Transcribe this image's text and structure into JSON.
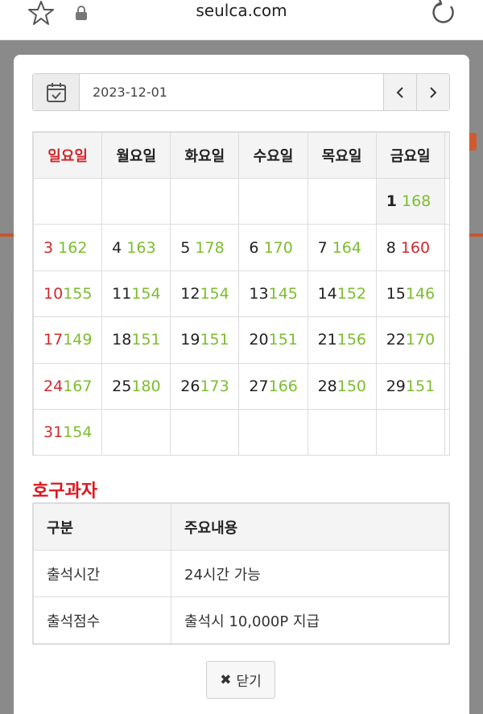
{
  "browser": {
    "url": "seulca.com"
  },
  "date_picker": {
    "value": "2023-12-01",
    "prev_label": "‹",
    "next_label": "›"
  },
  "calendar": {
    "weekdays": [
      "일요일",
      "월요일",
      "화요일",
      "수요일",
      "목요일",
      "금요일"
    ],
    "weeks": [
      [
        {
          "day": "",
          "count": ""
        },
        {
          "day": "",
          "count": ""
        },
        {
          "day": "",
          "count": ""
        },
        {
          "day": "",
          "count": ""
        },
        {
          "day": "",
          "count": ""
        },
        {
          "day": "1",
          "count": "168"
        }
      ],
      [
        {
          "day": "3",
          "count": "162"
        },
        {
          "day": "4",
          "count": "163"
        },
        {
          "day": "5",
          "count": "178"
        },
        {
          "day": "6",
          "count": "170"
        },
        {
          "day": "7",
          "count": "164"
        },
        {
          "day": "8",
          "count": "160"
        }
      ],
      [
        {
          "day": "10",
          "count": "155"
        },
        {
          "day": "11",
          "count": "154"
        },
        {
          "day": "12",
          "count": "154"
        },
        {
          "day": "13",
          "count": "145"
        },
        {
          "day": "14",
          "count": "152"
        },
        {
          "day": "15",
          "count": "146"
        }
      ],
      [
        {
          "day": "17",
          "count": "149"
        },
        {
          "day": "18",
          "count": "151"
        },
        {
          "day": "19",
          "count": "151"
        },
        {
          "day": "20",
          "count": "151"
        },
        {
          "day": "21",
          "count": "156"
        },
        {
          "day": "22",
          "count": "170"
        }
      ],
      [
        {
          "day": "24",
          "count": "167"
        },
        {
          "day": "25",
          "count": "180"
        },
        {
          "day": "26",
          "count": "173"
        },
        {
          "day": "27",
          "count": "166"
        },
        {
          "day": "28",
          "count": "150"
        },
        {
          "day": "29",
          "count": "151"
        }
      ],
      [
        {
          "day": "31",
          "count": "154"
        },
        {
          "day": "",
          "count": ""
        },
        {
          "day": "",
          "count": ""
        },
        {
          "day": "",
          "count": ""
        },
        {
          "day": "",
          "count": ""
        },
        {
          "day": "",
          "count": ""
        }
      ]
    ]
  },
  "section_title": "호구과자",
  "info_table": {
    "headers": [
      "구분",
      "주요내용"
    ],
    "rows": [
      [
        "출석시간",
        "24시간 가능"
      ],
      [
        "출석점수",
        "출석시 10,000P 지급"
      ]
    ]
  },
  "close_button": {
    "label": "닫기"
  },
  "colors": {
    "sunday_red": "#d2282c",
    "count_green": "#7cbd2f",
    "title_red": "#e0141b"
  }
}
